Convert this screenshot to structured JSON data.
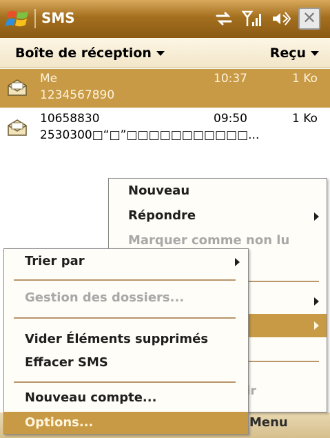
{
  "window": {
    "title": "SMS",
    "close_label": "✕",
    "status_icons": [
      "sync-icon",
      "signal-icon",
      "volume-icon"
    ]
  },
  "folderbar": {
    "folder": "Boîte de réception",
    "filter": "Reçu"
  },
  "messages": [
    {
      "from": "Me",
      "time": "10:37",
      "size": "1 Ko",
      "body": "1234567890",
      "selected": true
    },
    {
      "from": "10658830",
      "time": "09:50",
      "size": "1 Ko",
      "body": "2530300□“□”□□□□□□□□□□□...",
      "selected": false
    }
  ],
  "main_menu": {
    "items": [
      "Nouveau",
      "Répondre",
      "Marquer comme non lu"
    ],
    "partial_text": "oir"
  },
  "sub_menu": {
    "items": [
      "Trier par",
      "Gestion des dossiers...",
      "Vider Éléments supprimés",
      "Effacer SMS",
      "Nouveau compte...",
      "Options..."
    ]
  },
  "softkeys": {
    "right": "Menu"
  },
  "colors": {
    "accent": "#c89a45",
    "title_bar": "#a4701f",
    "disabled_text": "#a8a8a8"
  }
}
